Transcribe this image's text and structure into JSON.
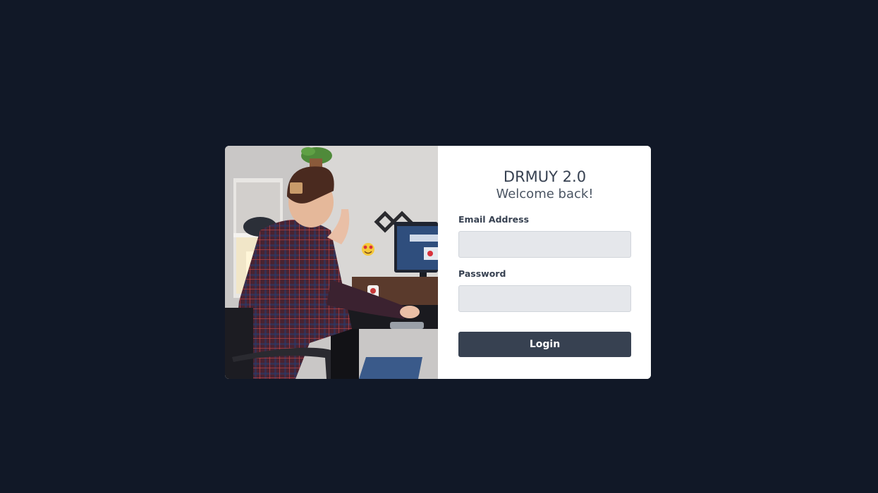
{
  "app": {
    "title": "DRMUY 2.0",
    "subtitle": "Welcome back!"
  },
  "form": {
    "email_label": "Email Address",
    "email_value": "",
    "email_placeholder": "",
    "password_label": "Password",
    "password_value": "",
    "password_placeholder": "",
    "login_label": "Login"
  },
  "colors": {
    "page_background": "#111827",
    "card_background": "#ffffff",
    "input_background": "#e5e7eb",
    "button_background": "#374151",
    "text_primary": "#374151"
  },
  "hero_image": {
    "icon": "person-at-desk-photo"
  }
}
